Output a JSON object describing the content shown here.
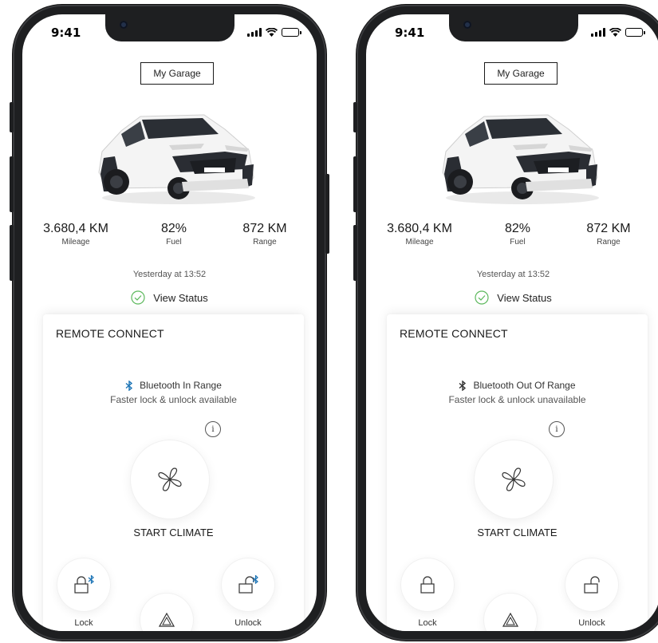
{
  "colors": {
    "accent": "#1a73b5",
    "check": "#5cb85c"
  },
  "screens": [
    {
      "status_time": "9:41",
      "garage_label": "My Garage",
      "stats": {
        "mileage_value": "3.680,4 KM",
        "mileage_label": "Mileage",
        "fuel_value": "82%",
        "fuel_label": "Fuel",
        "range_value": "872 KM",
        "range_label": "Range"
      },
      "updated": "Yesterday at 13:52",
      "view_status": "View Status",
      "remote": {
        "title": "REMOTE CONNECT",
        "bt_status": "Bluetooth In Range",
        "bt_sub": "Faster lock & unlock available",
        "info": "i",
        "climate_label": "START CLIMATE",
        "lock_label": "Lock",
        "unlock_label": "Unlock"
      }
    },
    {
      "status_time": "9:41",
      "garage_label": "My Garage",
      "stats": {
        "mileage_value": "3.680,4 KM",
        "mileage_label": "Mileage",
        "fuel_value": "82%",
        "fuel_label": "Fuel",
        "range_value": "872 KM",
        "range_label": "Range"
      },
      "updated": "Yesterday at 13:52",
      "view_status": "View Status",
      "remote": {
        "title": "REMOTE CONNECT",
        "bt_status": "Bluetooth Out Of Range",
        "bt_sub": "Faster lock & unlock unavailable",
        "info": "i",
        "climate_label": "START CLIMATE",
        "lock_label": "Lock",
        "unlock_label": "Unlock"
      }
    }
  ]
}
